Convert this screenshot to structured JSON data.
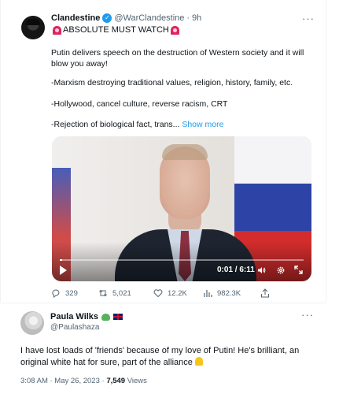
{
  "tweet": {
    "author_name": "Clandestine",
    "handle": "@WarClandestine",
    "separator": "·",
    "time": "9h",
    "more": "···",
    "headline": "ABSOLUTE MUST WATCH",
    "paragraphs": [
      "Putin delivers speech on the destruction of Western society and it will blow you away!",
      "-Marxism destroying traditional values, religion, history, family, etc.",
      "-Hollywood, cancel culture, reverse racism, CRT",
      "-Rejection of biological fact, trans..."
    ],
    "show_more": "Show more",
    "video": {
      "time_readout": "0:01 / 6:11",
      "progress": 0.003
    },
    "stats": {
      "replies": "329",
      "retweets": "5,021",
      "likes": "12.2K",
      "views": "982.3K"
    }
  },
  "reply": {
    "author_name": "Paula Wilks",
    "handle": "@Paulashaza",
    "more": "···",
    "text": "I have lost loads of 'friends' because of my love of Putin! He's brilliant, an original white hat for sure, part of the alliance",
    "timestamp": "3:08 AM · May 26, 2023 · ",
    "views_count": "7,549",
    "views_label": "Views"
  },
  "colors": {
    "accent": "#1d9bf0",
    "muted": "#536471"
  }
}
